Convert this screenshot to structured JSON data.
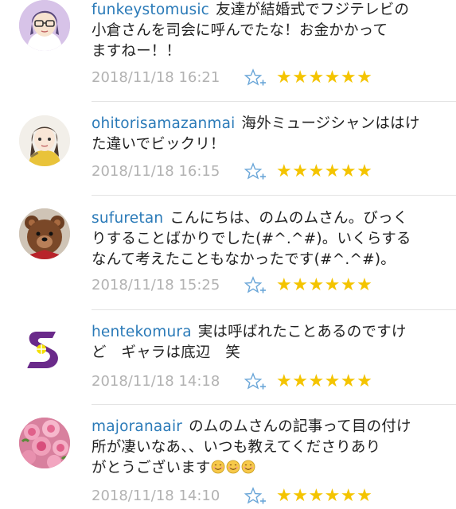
{
  "comments": [
    {
      "username": "funkeystomusic",
      "text_lines": [
        "友達が結婚式でフジテレビの",
        "小倉さんを司会に呼んでたな！お金かかって",
        "ますねー！！"
      ],
      "timestamp": "2018/11/18 16:21",
      "stars": "★★★★★★",
      "avatar_icon": "cartoon-glasses-avatar-icon"
    },
    {
      "username": "ohitorisamazanmai",
      "text_lines": [
        "海外ミュージシャンははけ",
        "た違いでビックリ！"
      ],
      "timestamp": "2018/11/18 16:15",
      "stars": "★★★★★★",
      "avatar_icon": "cartoon-girl-avatar-icon"
    },
    {
      "username": "sufuretan",
      "text_lines": [
        "こんにちは、のムのムさん。びっく",
        "りすることばかりでした(#^.^#)。いくらする",
        "なんて考えたこともなかったです(#^.^#)。"
      ],
      "timestamp": "2018/11/18 15:25",
      "stars": "★★★★★★",
      "avatar_icon": "teddy-bear-avatar-icon"
    },
    {
      "username": "hentekomura",
      "text_lines": [
        "実は呼ばれたことあるのですけ",
        "ど　ギャラは底辺　笑"
      ],
      "timestamp": "2018/11/18 14:18",
      "stars": "★★★★★★",
      "avatar_icon": "purple-s-logo-avatar-icon"
    },
    {
      "username": "majoranaair",
      "text_lines": [
        "のムのムさんの記事って目の付け",
        "所が凄いなあ、、いつも教えてくださりあり",
        "がとうございます"
      ],
      "emoji_count": 3,
      "emoji_icon": "smiling-face-emoji-icon",
      "timestamp": "2018/11/18 14:10",
      "stars": "★★★★★★",
      "avatar_icon": "pink-roses-avatar-icon"
    }
  ],
  "colors": {
    "username": "#2a7ab8",
    "text": "#222222",
    "timestamp": "#b2b2b2",
    "star": "#f4c400",
    "star_add": "#6aa6d8",
    "divider": "#e3e3e3"
  },
  "icons": {
    "add_star": "add-star-icon"
  }
}
